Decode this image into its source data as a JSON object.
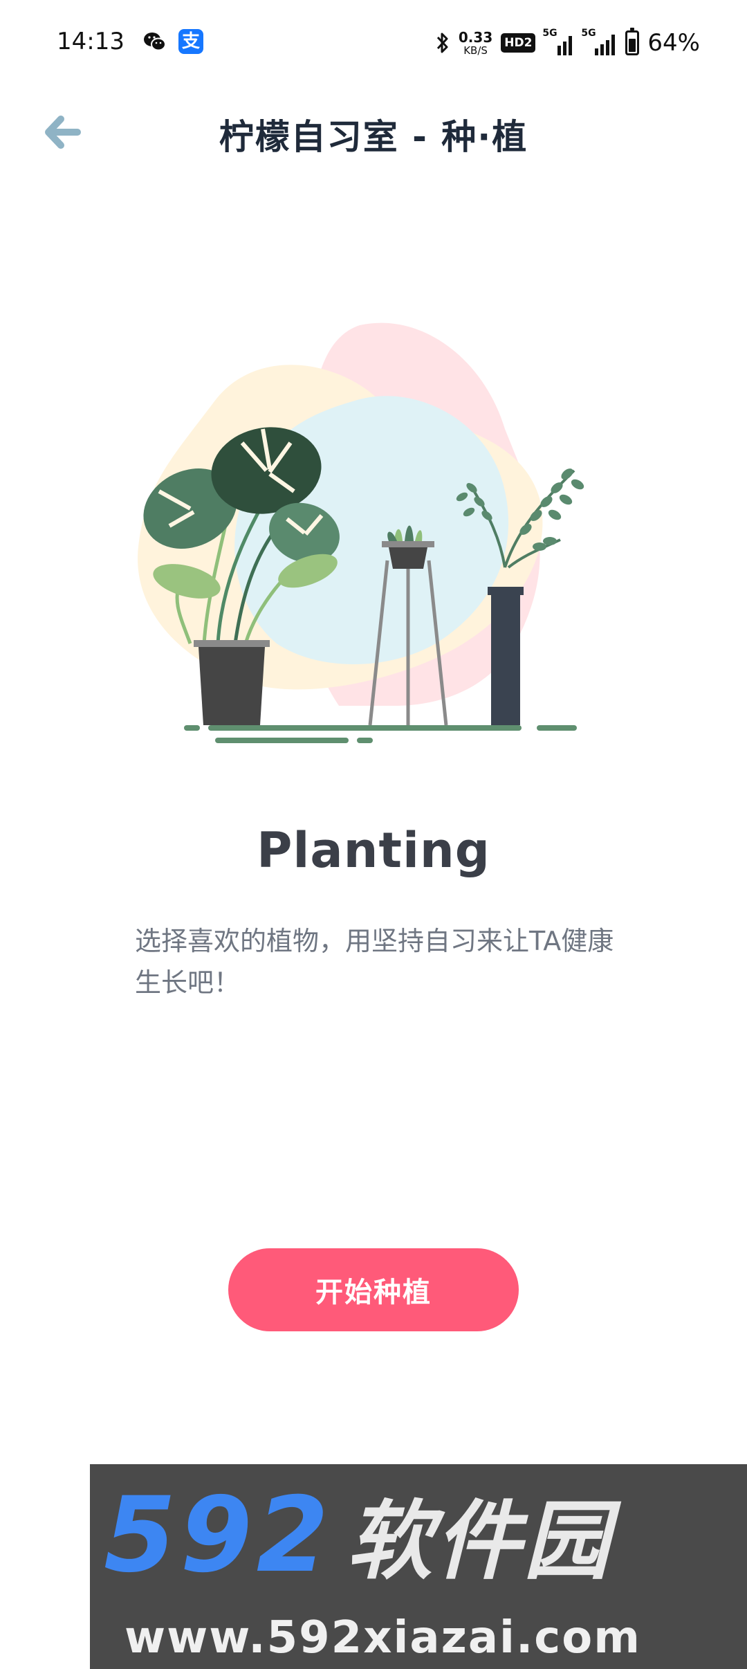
{
  "status_bar": {
    "time": "14:13",
    "net_speed_value": "0.33",
    "net_speed_unit": "KB/S",
    "hd_badge": "HD2",
    "sim1_label": "5G",
    "sim2_label": "5G",
    "battery_percent": "64%",
    "battery_level": 0.64,
    "icons": [
      "wechat-icon",
      "alipay-icon",
      "bluetooth-icon",
      "signal-icon",
      "battery-icon"
    ]
  },
  "alipay_glyph": "支",
  "header": {
    "title": "柠檬自习室 - 种·植",
    "back_icon": "arrow-left-icon"
  },
  "illustration": {
    "description_icon": "plants-illustration"
  },
  "content": {
    "headline": "Planting",
    "description": "选择喜欢的植物，用坚持自习来让TA健康生长吧！"
  },
  "cta": {
    "start_label": "开始种植"
  },
  "watermark": {
    "number": "592",
    "name": "软件园",
    "url": "www.592xiazai.com"
  },
  "colors": {
    "accent": "#ff5a79",
    "title": "#1f2a3a",
    "back_arrow": "#8fb3c5",
    "watermark_blue": "#3d86f2"
  }
}
